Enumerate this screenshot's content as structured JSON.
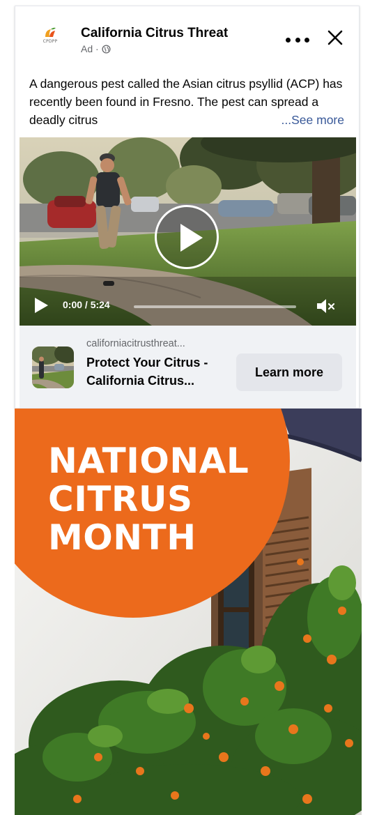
{
  "ad": {
    "advertiser_name": "California Citrus Threat",
    "sponsored_label": "Ad ·",
    "logo_text": "CPDPP",
    "body_text": "A dangerous pest called the Asian citrus psyllid (ACP) has recently been found in Fresno. The pest can spread a deadly citrus",
    "see_more": "...See more",
    "more_icon": "more-horizontal-icon",
    "close_icon": "close-icon"
  },
  "video": {
    "time": "0:00 / 5:24",
    "progress": 0.0,
    "play_icon": "play-icon",
    "mute_icon": "volume-muted-icon"
  },
  "link": {
    "domain": "californiacitrusthreat...",
    "title": "Protect Your Citrus - California Citrus...",
    "cta_label": "Learn more"
  },
  "banner": {
    "line1": "NATIONAL",
    "line2": "CITRUS",
    "line3": "MONTH"
  },
  "colors": {
    "banner_orange": "#ec6a1c",
    "link_blue": "#385898",
    "button_gray": "#e4e6eb",
    "footer_bg": "#f0f2f5"
  }
}
